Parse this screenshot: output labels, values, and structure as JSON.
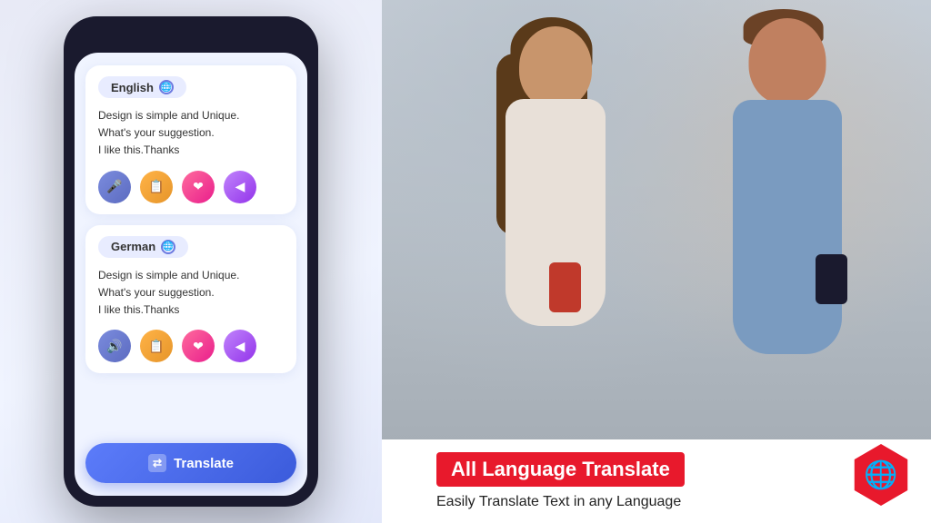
{
  "phone": {
    "card1": {
      "language": "English",
      "text_line1": "Design is simple and Unique.",
      "text_line2": "What's your suggestion.",
      "text_line3": "I like this.Thanks"
    },
    "card2": {
      "language": "German",
      "text_line1": "Design is simple and Unique.",
      "text_line2": "What's your suggestion.",
      "text_line3": "I like this.Thanks"
    },
    "translate_btn": "Translate"
  },
  "banner": {
    "title": "All Language Translate",
    "subtitle": "Easily Translate Text in any  Language"
  },
  "icons": {
    "globe": "🌐",
    "mic": "🎤",
    "copy": "📋",
    "heart": "❤",
    "share": "◁",
    "speaker": "🔊",
    "translate": "⇄"
  },
  "colors": {
    "accent_blue": "#5c7cfa",
    "accent_red": "#e8192c",
    "card_bg": "#ffffff",
    "screen_bg": "#f0f4ff",
    "phone_frame": "#1a1a2e"
  }
}
